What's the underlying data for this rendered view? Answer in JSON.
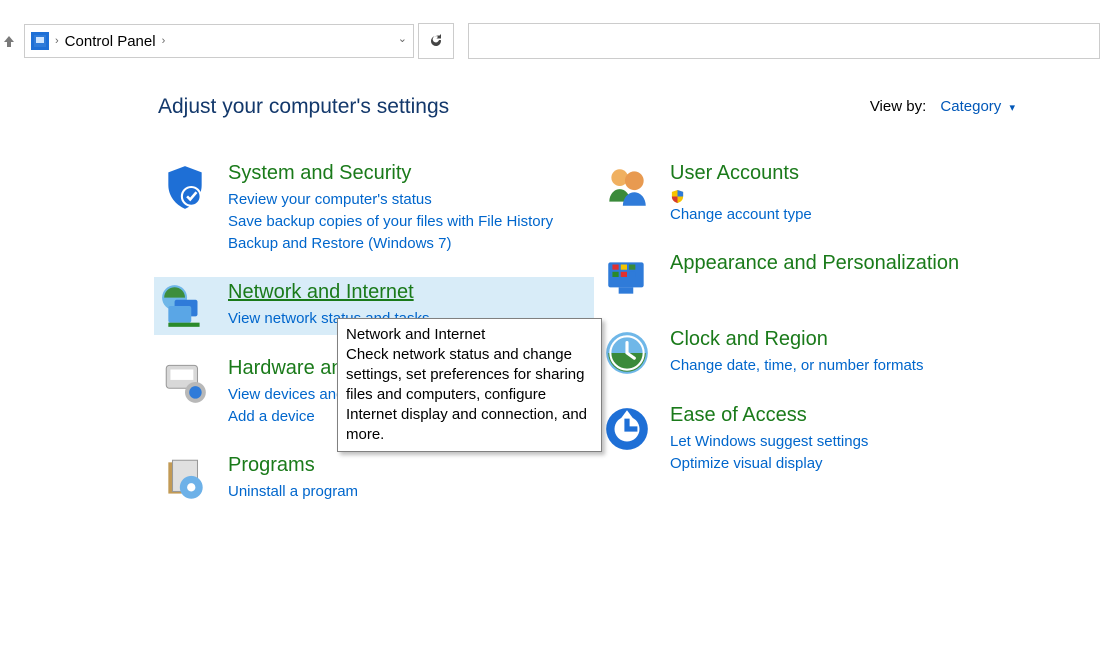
{
  "nav": {
    "crumb": "Control Panel"
  },
  "heading": "Adjust your computer's settings",
  "viewby": {
    "label": "View by:",
    "value": "Category"
  },
  "col1": [
    {
      "title": "System and Security",
      "links": [
        "Review your computer's status",
        "Save backup copies of your files with File History",
        "Backup and Restore (Windows 7)"
      ]
    },
    {
      "title": "Network and Internet",
      "links": [
        "View network status and tasks"
      ],
      "hover": true
    },
    {
      "title": "Hardware and Sound",
      "links": [
        "View devices and printers",
        "Add a device"
      ]
    },
    {
      "title": "Programs",
      "links": [
        "Uninstall a program"
      ]
    }
  ],
  "col2": [
    {
      "title": "User Accounts",
      "links": [
        "Change account type"
      ],
      "shield": true
    },
    {
      "title": "Appearance and Personalization",
      "links": []
    },
    {
      "title": "Clock and Region",
      "links": [
        "Change date, time, or number formats"
      ]
    },
    {
      "title": "Ease of Access",
      "links": [
        "Let Windows suggest settings",
        "Optimize visual display"
      ]
    }
  ],
  "tooltip": {
    "title": "Network and Internet",
    "body": "Check network status and change settings, set preferences for sharing files and computers, configure Internet display and connection, and more."
  }
}
